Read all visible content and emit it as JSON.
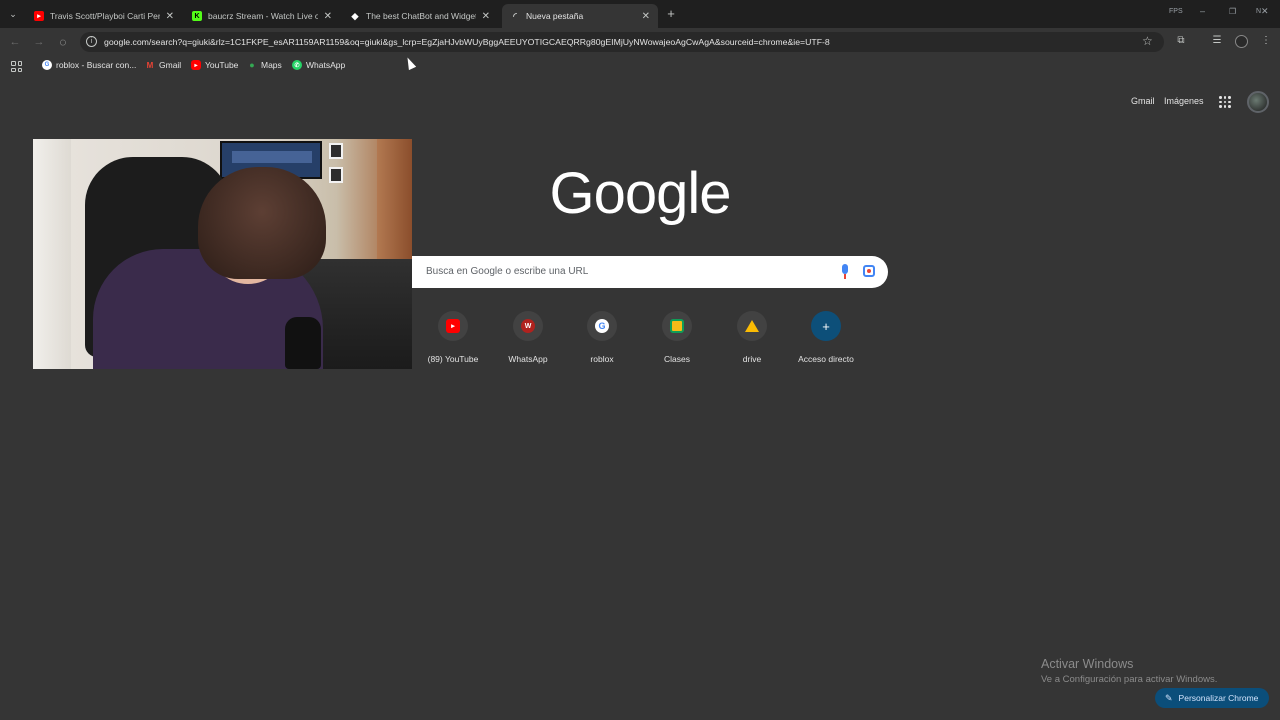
{
  "tabs": [
    {
      "title": "Travis Scott/Playboi Carti Perfec",
      "icon": "youtube-icon"
    },
    {
      "title": "baucrz Stream - Watch Live on",
      "icon": "kick-icon"
    },
    {
      "title": "The best ChatBot and Widgets",
      "icon": "streamelements-icon"
    },
    {
      "title": "Nueva pestaña",
      "icon": "loading-icon",
      "active": true
    }
  ],
  "window_controls": {
    "fps": "FPS",
    "extra": "N"
  },
  "toolbar": {
    "url": "google.com/search?q=giuki&rlz=1C1FKPE_esAR1159AR1159&oq=giuki&gs_lcrp=EgZjaHJvbWUyBggAEEUYOTIGCAEQRRg80gEIMjUyNWowajeoAgCwAgA&sourceid=chrome&ie=UTF-8"
  },
  "bookmarks": [
    {
      "label": "roblox - Buscar con...",
      "icon": "google-icon"
    },
    {
      "label": "Gmail",
      "icon": "gmail-icon"
    },
    {
      "label": "YouTube",
      "icon": "youtube-icon"
    },
    {
      "label": "Maps",
      "icon": "maps-icon"
    },
    {
      "label": "WhatsApp",
      "icon": "whatsapp-icon"
    }
  ],
  "header": {
    "gmail": "Gmail",
    "images": "Imágenes"
  },
  "logo": "Google",
  "search": {
    "placeholder": "Busca en Google o escribe una URL"
  },
  "shortcuts": [
    {
      "label": "(89) YouTube",
      "icon": "youtube-icon"
    },
    {
      "label": "WhatsApp",
      "icon": "w-icon"
    },
    {
      "label": "roblox",
      "icon": "google-icon"
    },
    {
      "label": "Clases",
      "icon": "classroom-icon"
    },
    {
      "label": "drive",
      "icon": "drive-icon"
    },
    {
      "label": "Acceso directo",
      "icon": "plus-icon"
    }
  ],
  "watermark": {
    "line1": "Activar Windows",
    "line2": "Ve a Configuración para activar Windows."
  },
  "customize": {
    "label": "Personalizar Chrome"
  },
  "colors": {
    "background": "#353535",
    "tabstrip": "#1f1f1f",
    "accent": "#0b4e7a",
    "youtube": "#ff0000",
    "kick": "#53fc18"
  }
}
